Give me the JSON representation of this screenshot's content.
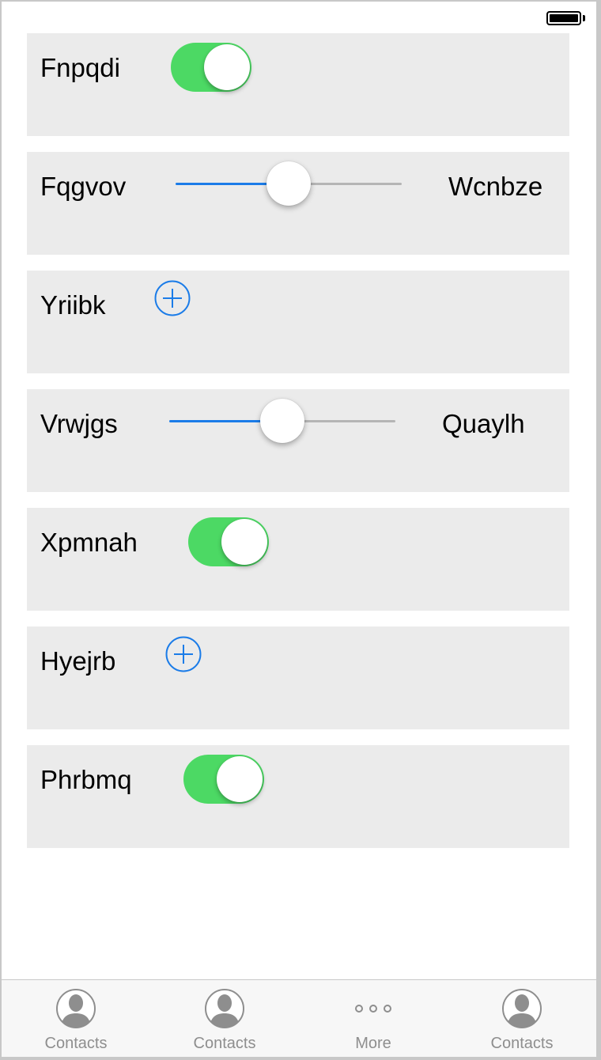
{
  "status_bar": {
    "battery_level": 1.0
  },
  "rows": [
    {
      "type": "toggle",
      "label": "Fnpqdi",
      "on": true
    },
    {
      "type": "slider",
      "label": "Fqgvov",
      "value": 0.5,
      "max_label": "Wcnbze"
    },
    {
      "type": "add",
      "label": "Yriibk",
      "icon": "add-circle-icon"
    },
    {
      "type": "slider",
      "label": "Vrwjgs",
      "value": 0.5,
      "max_label": "Quaylh"
    },
    {
      "type": "toggle",
      "label": "Xpmnah",
      "on": true
    },
    {
      "type": "add",
      "label": "Hyejrb",
      "icon": "add-circle-icon"
    },
    {
      "type": "toggle",
      "label": "Phrbmq",
      "on": true
    }
  ],
  "tabbar": {
    "tabs": [
      {
        "label": "Contacts",
        "icon": "contact-icon"
      },
      {
        "label": "Contacts",
        "icon": "contact-icon"
      },
      {
        "label": "More",
        "icon": "more-icon"
      },
      {
        "label": "Contacts",
        "icon": "contact-icon"
      }
    ]
  },
  "colors": {
    "toggle_on": "#4cd964",
    "tint": "#1b7ce8",
    "row_background": "#ebebeb",
    "tab_label": "#8e8e8e"
  }
}
